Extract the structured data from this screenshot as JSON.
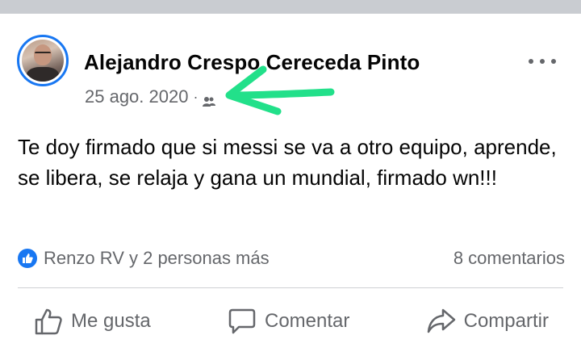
{
  "post": {
    "author_name": "Alejandro Crespo Cereceda Pinto",
    "date": "25 ago. 2020",
    "meta_separator": "·",
    "privacy_icon": "friends-icon",
    "text": "Te doy firmado que si messi se va a otro equipo, aprende, se libera, se relaja y gana un mundial, firmado wn!!!"
  },
  "reactions": {
    "summary": "Renzo RV y 2 personas más",
    "comments": "8 comentarios"
  },
  "actions": {
    "like_label": "Me gusta",
    "comment_label": "Comentar",
    "share_label": "Compartir"
  },
  "colors": {
    "brand_blue": "#1877f2",
    "secondary_text": "#65676b",
    "annotation_green": "#22e08a",
    "divider": "#ced0d4"
  }
}
